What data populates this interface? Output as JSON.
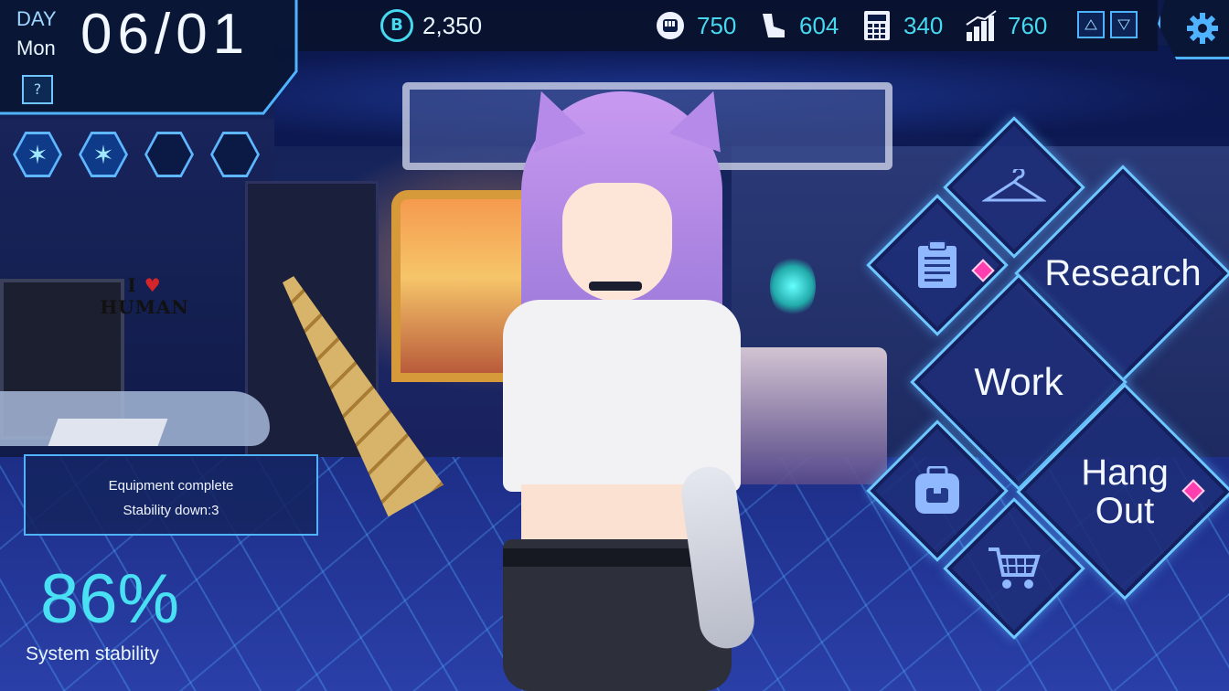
{
  "hud": {
    "day_label": "DAY",
    "weekday": "Mon",
    "date": "06/01",
    "help_label": "?"
  },
  "currency": {
    "icon": "coin-icon",
    "symbol": "B",
    "value": "2,350"
  },
  "stats": [
    {
      "name": "strength",
      "icon": "fist-icon",
      "value": "750"
    },
    {
      "name": "agility",
      "icon": "leg-icon",
      "value": "604"
    },
    {
      "name": "intelligence",
      "icon": "calculator-icon",
      "value": "340"
    },
    {
      "name": "growth",
      "icon": "bar-chart-icon",
      "value": "760"
    }
  ],
  "hexes": [
    {
      "filled": true
    },
    {
      "filled": true
    },
    {
      "filled": false
    },
    {
      "filled": false
    }
  ],
  "message": {
    "line1": "Equipment complete",
    "line2": "Stability down:3"
  },
  "stability": {
    "value": "86%",
    "label": "System stability"
  },
  "shirt": {
    "line1": "I",
    "heart": "♥",
    "line2": "HUMAN"
  },
  "menu": {
    "wardrobe_icon": "hanger-icon",
    "quest_icon": "clipboard-icon",
    "research_label": "Research",
    "work_label": "Work",
    "inventory_icon": "backpack-icon",
    "hangout_label_1": "Hang",
    "hangout_label_2": "Out",
    "shop_icon": "cart-icon"
  },
  "colors": {
    "accent": "#46d9f0",
    "frame": "#6ec8ff",
    "notification": "#ff3fb0"
  }
}
